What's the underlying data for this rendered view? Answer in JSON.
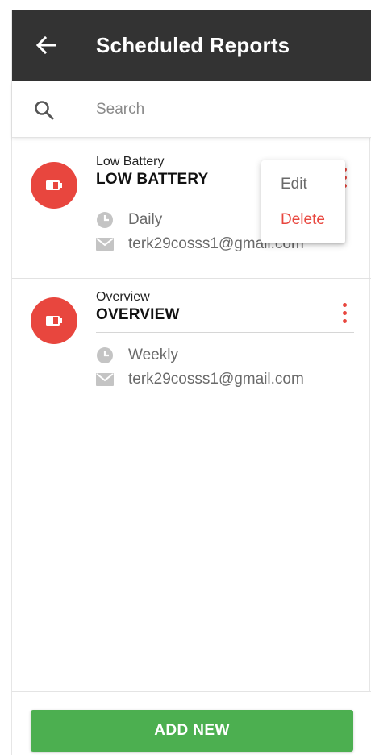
{
  "header": {
    "title": "Scheduled Reports",
    "back_icon": "arrow-left-icon",
    "background": "#333333"
  },
  "search": {
    "placeholder": "Search",
    "icon": "search-icon"
  },
  "reports": [
    {
      "label": "Low Battery",
      "name": "LOW BATTERY",
      "frequency": "Daily",
      "email": "terk29cosss1@gmail.com",
      "icon": "battery-icon"
    },
    {
      "label": "Overview",
      "name": "OVERVIEW",
      "frequency": "Weekly",
      "email": "terk29cosss1@gmail.com",
      "icon": "battery-icon"
    }
  ],
  "context_menu": {
    "edit_label": "Edit",
    "delete_label": "Delete"
  },
  "footer": {
    "add_label": "ADD NEW"
  },
  "colors": {
    "accent_red": "#e8463e",
    "accent_green": "#4caf50"
  }
}
